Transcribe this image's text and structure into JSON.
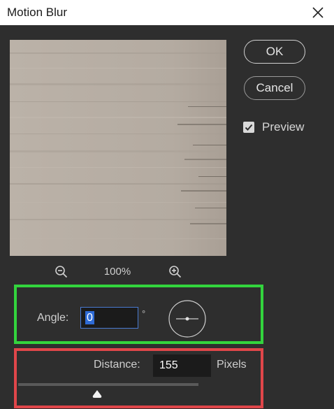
{
  "dialog": {
    "title": "Motion Blur"
  },
  "buttons": {
    "ok_label": "OK",
    "cancel_label": "Cancel"
  },
  "preview": {
    "label": "Preview",
    "checked": true
  },
  "zoom": {
    "level": "100%"
  },
  "angle": {
    "label": "Angle:",
    "value": "0",
    "unit": "°"
  },
  "distance": {
    "label": "Distance:",
    "value": "155",
    "unit": "Pixels",
    "slider_fraction": 0.44
  },
  "colors": {
    "dialog_bg": "#2e2e2e",
    "highlight_green": "#33d43d",
    "highlight_red": "#e0464a",
    "input_focus": "#4a7bd1"
  },
  "icons": {
    "close": "close-icon",
    "checkbox": "checkmark-icon",
    "zoom_out": "zoom-out-icon",
    "zoom_in": "zoom-in-icon",
    "dial": "angle-dial-icon",
    "slider_thumb": "slider-thumb-icon"
  }
}
